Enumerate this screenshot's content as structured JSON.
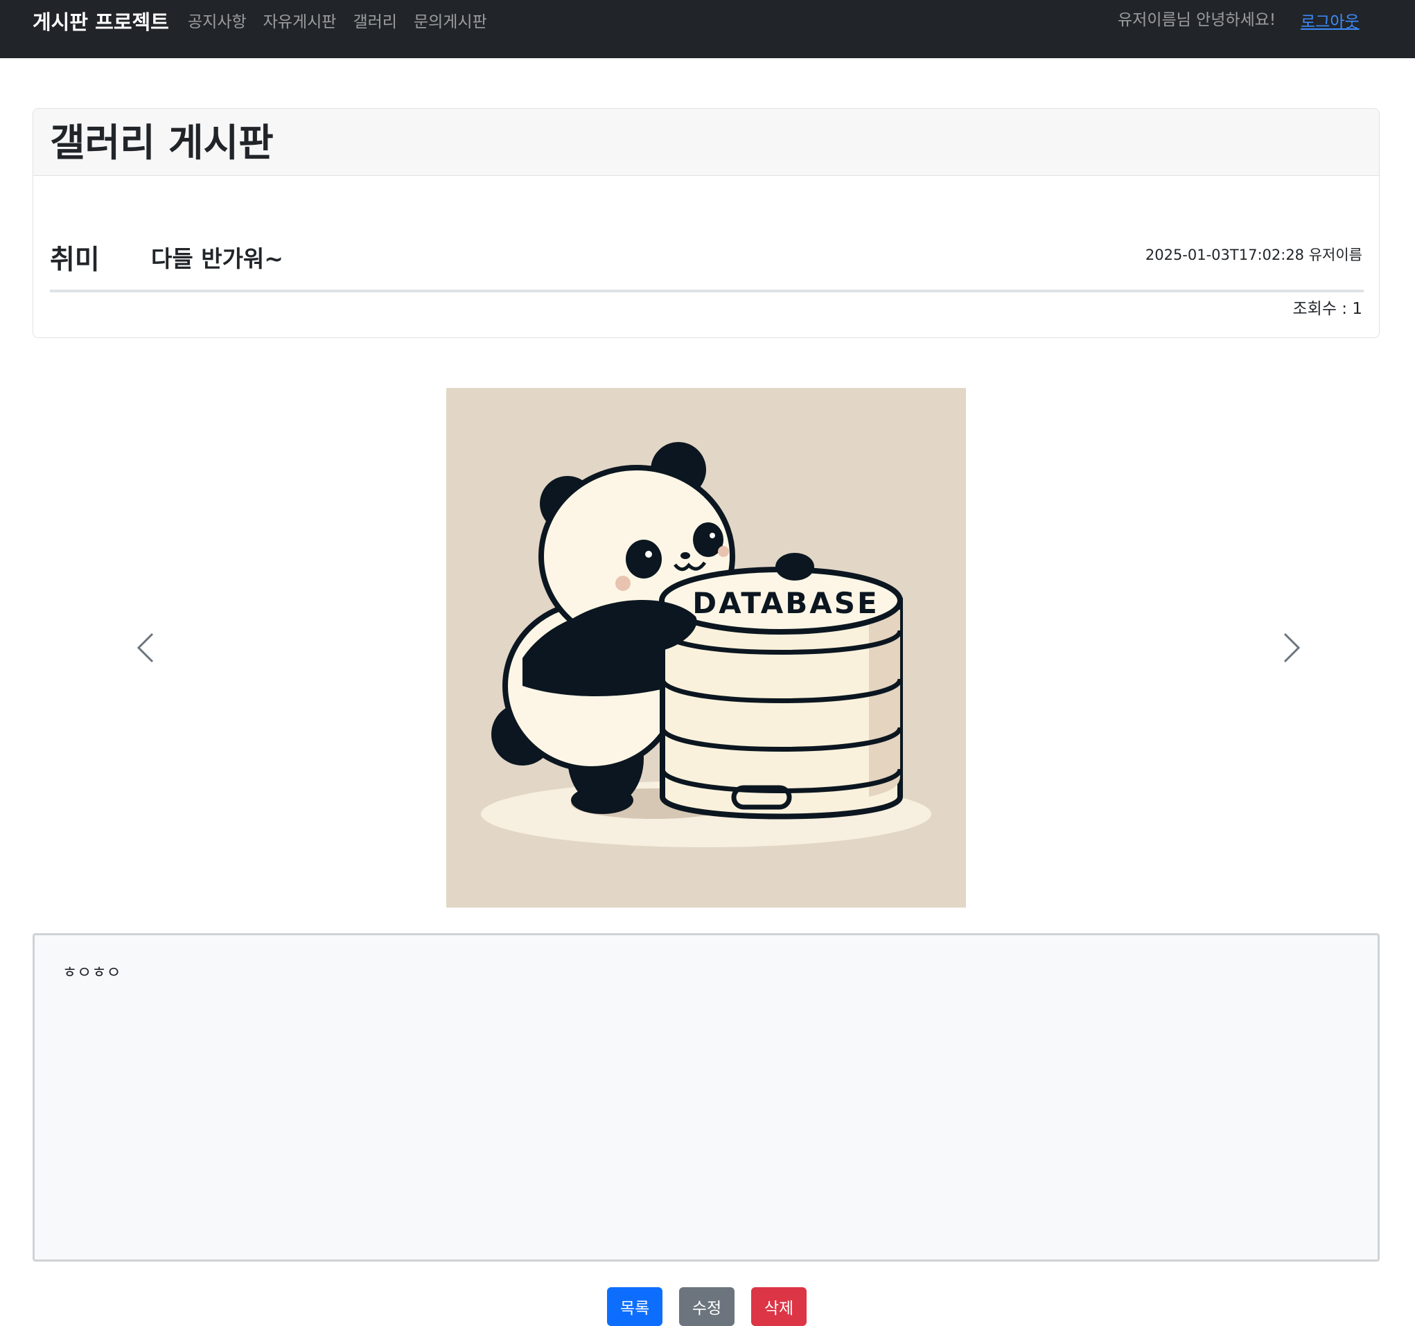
{
  "navbar": {
    "brand": "게시판 프로젝트",
    "links": [
      "공지사항",
      "자유게시판",
      "갤러리",
      "문의게시판"
    ],
    "greeting": "유저이름님 안녕하세요!",
    "logout": "로그아웃"
  },
  "board": {
    "title": "갤러리 게시판"
  },
  "post": {
    "category": "취미",
    "title": "다들 반가워~",
    "meta": "2025-01-03T17:02:28 유저이름",
    "views": "조회수 : 1",
    "content": "ㅎㅇㅎㅇ"
  },
  "carousel": {
    "image_text": "DATABASE",
    "slide_count": 3,
    "active_slide": 3,
    "prev_icon": "chevron-left-icon",
    "next_icon": "chevron-right-icon"
  },
  "actions": {
    "list_label": "목록",
    "edit_label": "수정",
    "delete_label": "삭제"
  },
  "colors": {
    "navbar_bg": "#212529",
    "primary": "#0d6efd",
    "secondary": "#6c757d",
    "danger": "#dc3545",
    "image_bg": "#e2d6c6"
  }
}
